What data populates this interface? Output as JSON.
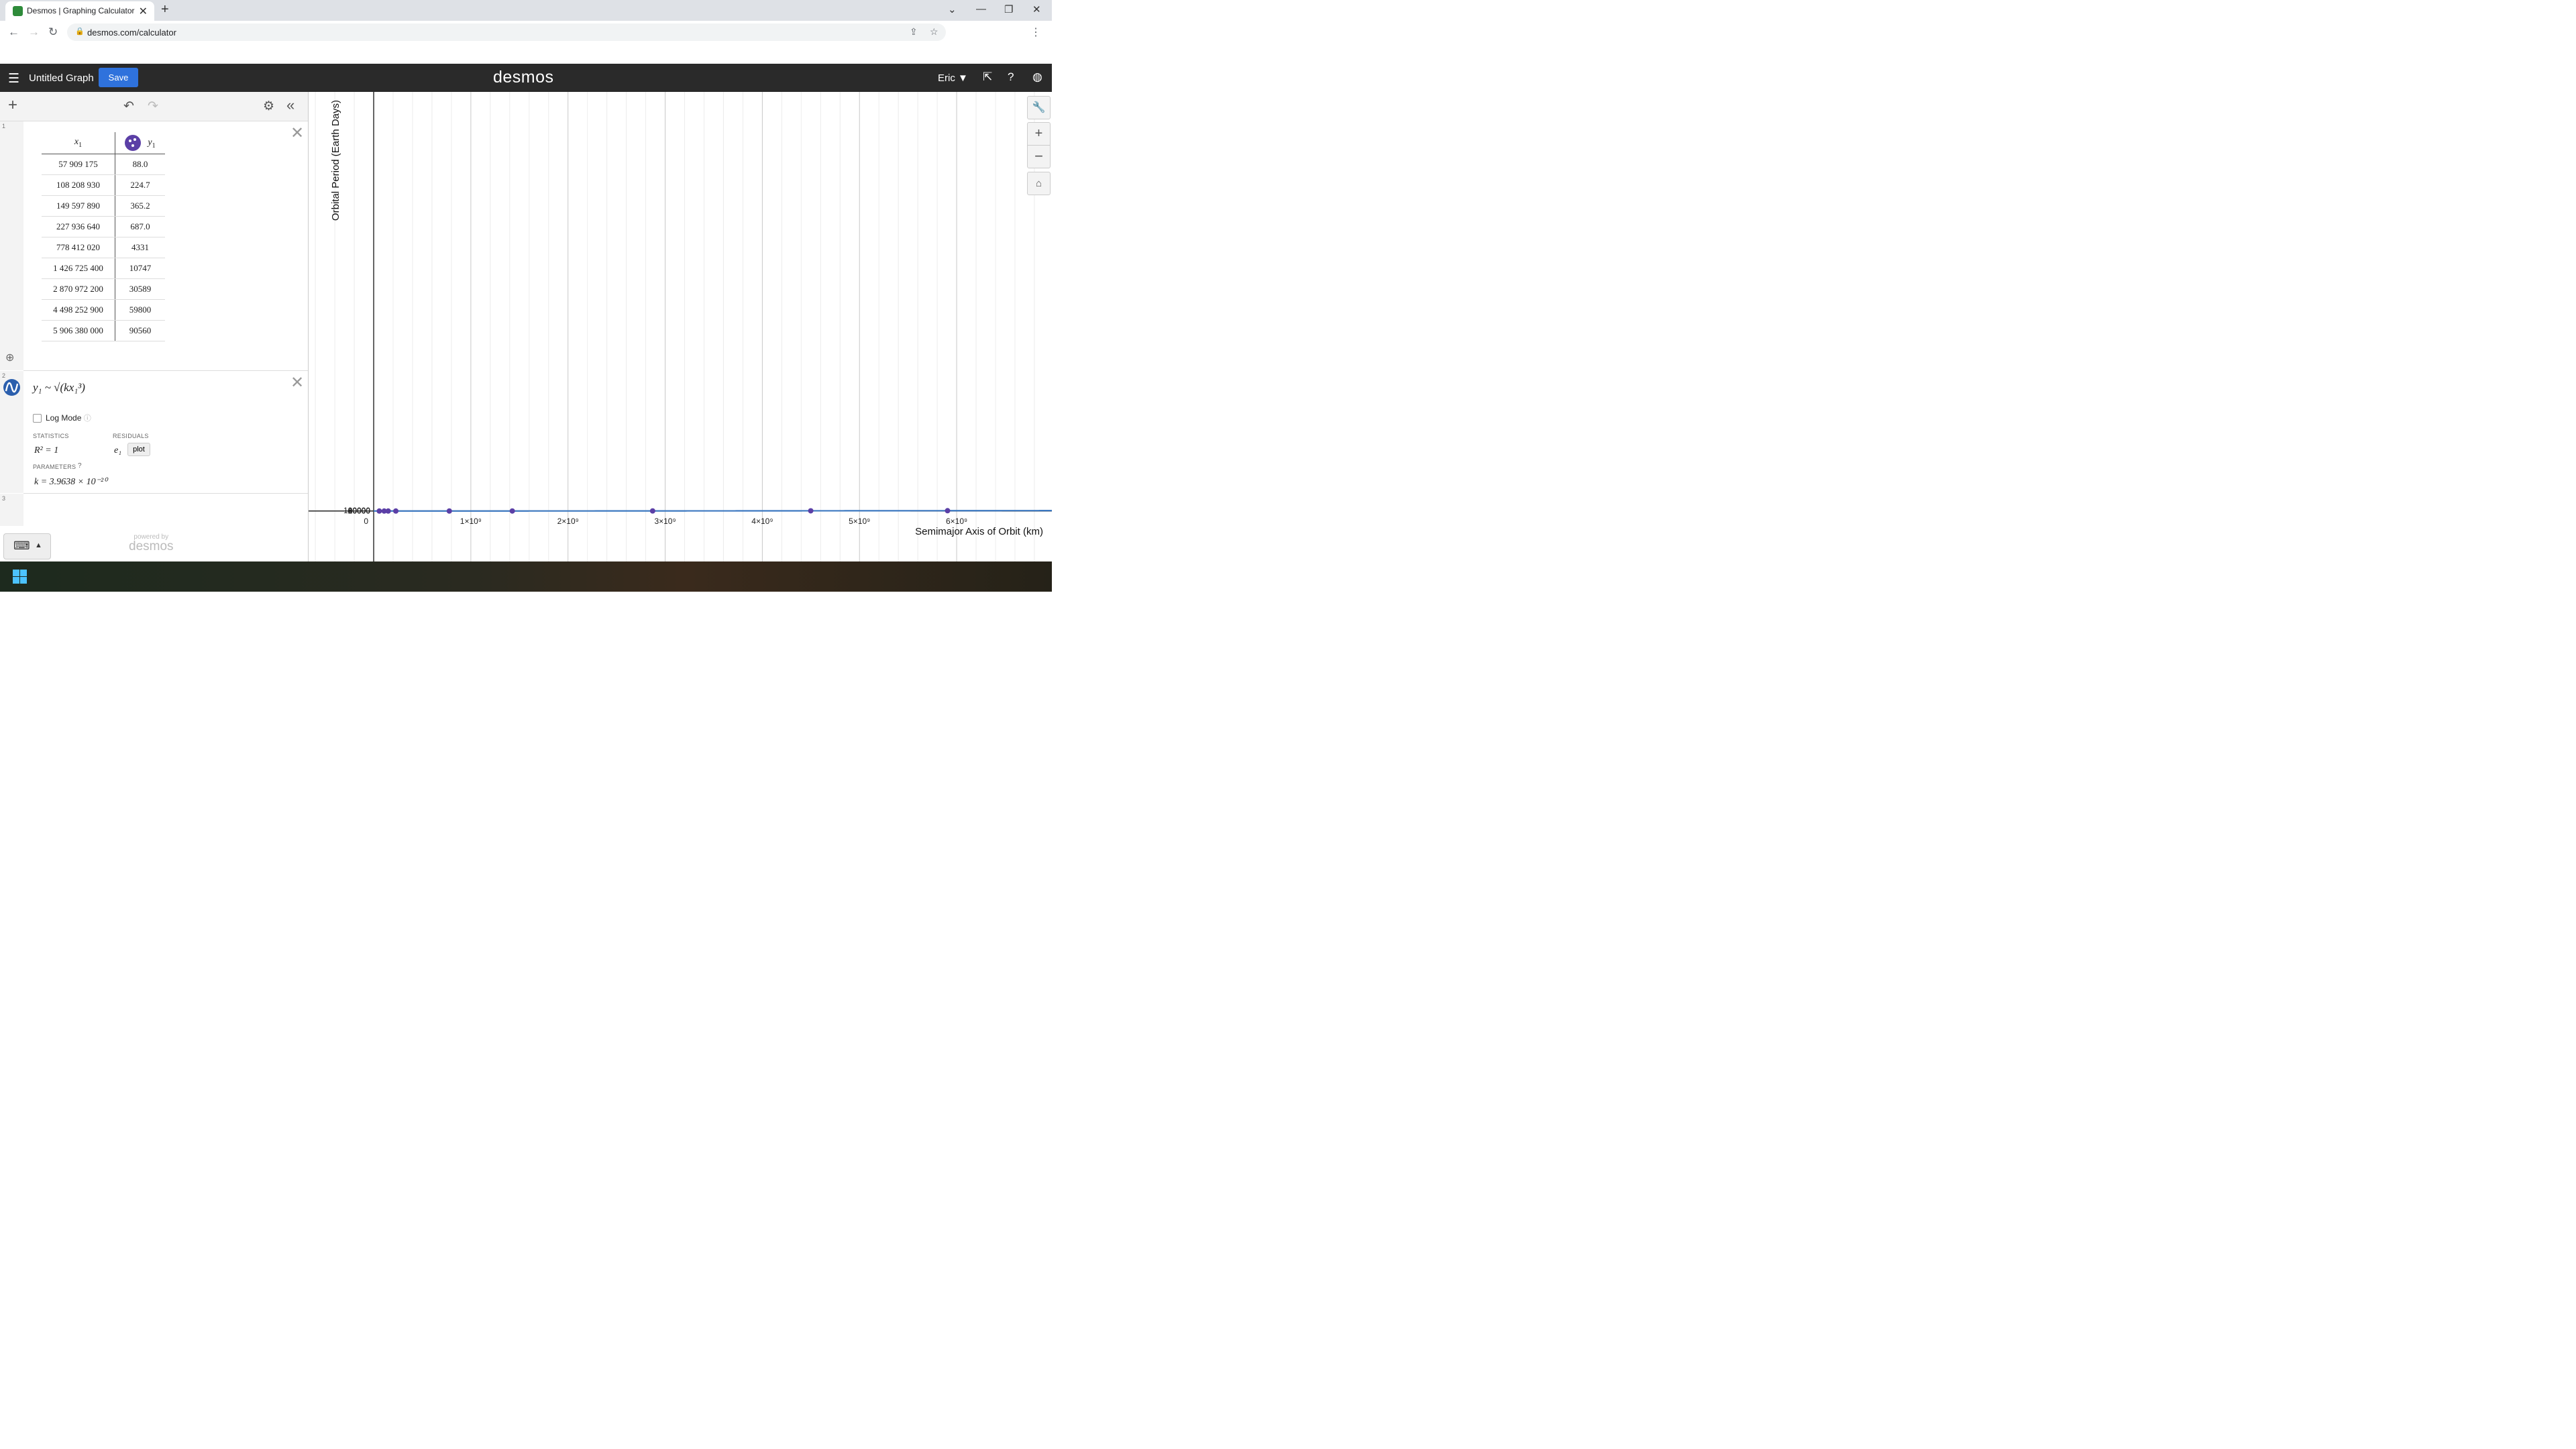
{
  "browser": {
    "tab_title": "Desmos | Graphing Calculator",
    "tab_close": "✕",
    "new_tab": "+",
    "url": "desmos.com/calculator",
    "window_controls": [
      "⌄",
      "—",
      "❐",
      "✕"
    ]
  },
  "header": {
    "graph_title": "Untitled Graph",
    "save_label": "Save",
    "logo": "desmos",
    "user_name": "Eric"
  },
  "expressions": {
    "row_numbers": [
      "1",
      "2",
      "3"
    ],
    "table": {
      "x_header": "x",
      "x_sub": "1",
      "y_header": "y",
      "y_sub": "1",
      "rows": [
        [
          "57 909 175",
          "88.0"
        ],
        [
          "108 208 930",
          "224.7"
        ],
        [
          "149 597 890",
          "365.2"
        ],
        [
          "227 936 640",
          "687.0"
        ],
        [
          "778 412 020",
          "4331"
        ],
        [
          "1 426 725 400",
          "10747"
        ],
        [
          "2 870 972 200",
          "30589"
        ],
        [
          "4 498 252 900",
          "59800"
        ],
        [
          "5 906 380 000",
          "90560"
        ]
      ]
    },
    "regression": {
      "formula": "y₁ ~ √(kx₁³)",
      "log_mode_label": "Log Mode",
      "statistics_label": "STATISTICS",
      "r_squared": "R² = 1",
      "residuals_label": "RESIDUALS",
      "residual_var": "e₁",
      "plot_label": "plot",
      "parameters_label": "PARAMETERS",
      "parameter_k": "k = 3.9638 × 10⁻²⁰"
    },
    "powered_by": "powered by",
    "powered_logo": "desmos"
  },
  "chart_data": {
    "type": "scatter",
    "xlabel": "Semimajor Axis of Orbit (km)",
    "ylabel": "Orbital Period (Earth Days)",
    "xlim": [
      -670000000,
      6980000000
    ],
    "ylim": [
      -13700000,
      113800000
    ],
    "x_ticks": [
      "0",
      "1×10⁹",
      "2×10⁹",
      "3×10⁹",
      "4×10⁹",
      "5×10⁹",
      "6×10⁹"
    ],
    "y_ticks": [
      "20000",
      "40000",
      "60000",
      "80000",
      "100000"
    ],
    "series": [
      {
        "points": [
          [
            57909175,
            88.0
          ],
          [
            108208930,
            224.7
          ],
          [
            149597890,
            365.2
          ],
          [
            227936640,
            687.0
          ],
          [
            778412020,
            4331
          ],
          [
            1426725400,
            10747
          ],
          [
            2870972200,
            30589
          ],
          [
            4498252900,
            59800
          ],
          [
            5906380000,
            90560
          ]
        ],
        "color": "#5b3fa6"
      }
    ],
    "fit": {
      "k": 3.9638e-20,
      "color": "#3c78c0"
    },
    "grid": true
  }
}
